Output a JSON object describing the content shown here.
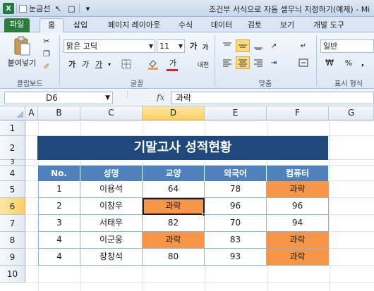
{
  "titlebar": {
    "qat_label": "눈금선",
    "title": "조건부 서식으로 자동 셀무늬 지정하기(예제) - Mi"
  },
  "ribbon_tabs": [
    "파일",
    "홈",
    "삽입",
    "페이지 레이아웃",
    "수식",
    "데이터",
    "검토",
    "보기",
    "개발 도구"
  ],
  "ribbon": {
    "paste_label": "붙여넣기",
    "clipboard_group": "클립보드",
    "font_name": "맑은 고딕",
    "font_size": "11",
    "font_group": "글꼴",
    "bold": "가",
    "italic": "가",
    "underline": "가",
    "grow_font": "가",
    "shrink_font": "가",
    "font_color_glyph": "가",
    "phonetic": "내천",
    "alignment_group": "맞춤",
    "number_format": "일반",
    "percent": "%",
    "comma": ",",
    "number_group": "표시 형식"
  },
  "formula_bar": {
    "name_box": "D6",
    "fx": "fx",
    "formula": "과락"
  },
  "columns": [
    "A",
    "B",
    "C",
    "D",
    "E",
    "F",
    "G"
  ],
  "rows": [
    "1",
    "2",
    "3",
    "4",
    "5",
    "6",
    "7",
    "8",
    "9",
    "10"
  ],
  "sheet": {
    "title": "기말고사 성적현황",
    "headers": [
      "No.",
      "성명",
      "교양",
      "외국어",
      "컴퓨터"
    ],
    "records": [
      [
        "1",
        "이용석",
        "64",
        "78",
        "과락"
      ],
      [
        "2",
        "이창우",
        "과락",
        "96",
        "96"
      ],
      [
        "3",
        "서태우",
        "82",
        "70",
        "94"
      ],
      [
        "4",
        "이군웅",
        "과락",
        "83",
        "과락"
      ],
      [
        "4",
        "장창석",
        "80",
        "93",
        "과락"
      ]
    ],
    "highlight_color": "#f79646",
    "header_color": "#4f81bd",
    "banner_color": "#1f497d"
  }
}
